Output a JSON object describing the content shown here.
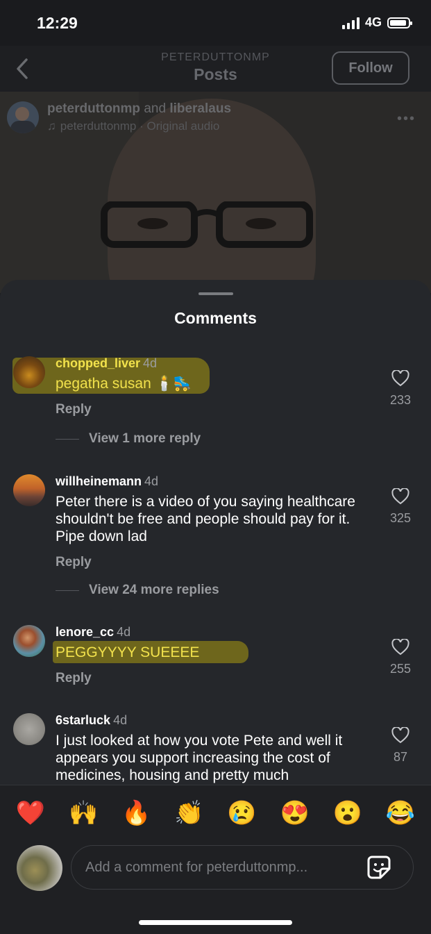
{
  "status_bar": {
    "time": "12:29",
    "network": "4G"
  },
  "header": {
    "subtitle": "PETERDUTTONMP",
    "title": "Posts",
    "follow_label": "Follow"
  },
  "post": {
    "author": "peterduttonmp",
    "and": " and ",
    "collaborator": "liberalaus",
    "audio": "peterduttonmp · Original audio"
  },
  "comments_sheet": {
    "title": "Comments",
    "reply_label": "Reply",
    "comments": [
      {
        "user": "chopped_liver",
        "time": "4d",
        "text": "pegatha susan 🕯️🛼",
        "likes": "233",
        "view_more": "View 1 more reply",
        "highlighted": true
      },
      {
        "user": "willheinemann",
        "time": "4d",
        "text": "Peter there is a video of you saying healthcare shouldn't be free and people should pay for it. Pipe down lad",
        "likes": "325",
        "view_more": "View 24 more replies",
        "highlighted": false
      },
      {
        "user": "lenore_cc",
        "time": "4d",
        "text": "PEGGYYYY SUEEEE",
        "likes": "255",
        "highlighted": true
      },
      {
        "user": "6starluck",
        "time": "4d",
        "text": "I just looked at how you vote Pete and well it appears you support increasing the cost of medicines, housing and pretty much",
        "likes": "87",
        "highlighted": false
      }
    ]
  },
  "reactions": [
    "❤️",
    "🙌",
    "🔥",
    "👏",
    "😢",
    "😍",
    "😮",
    "😂"
  ],
  "composer": {
    "placeholder": "Add a comment for peterduttonmp..."
  },
  "colors": {
    "highlight": "#d6be14",
    "sheet_bg": "#25272b",
    "page_bg": "#1b1c1f"
  }
}
